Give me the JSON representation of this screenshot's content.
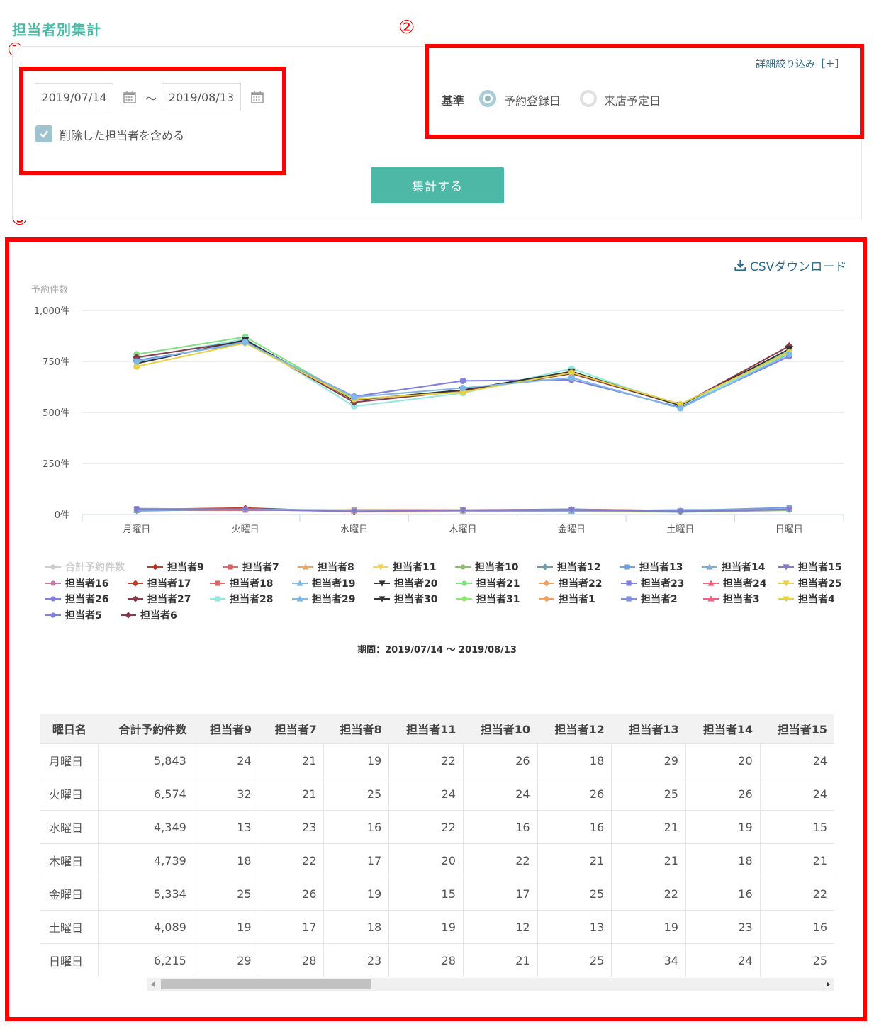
{
  "page": {
    "title": "担当者別集計"
  },
  "annotations": [
    "①",
    "②",
    "③"
  ],
  "filter": {
    "date_from": "2019/07/14",
    "date_to": "2019/08/13",
    "range_sep": "～",
    "include_deleted_label": "削除した担当者を含める",
    "detail_filter_link": "詳細絞り込み［＋］",
    "basis_label": "基準",
    "basis_options": [
      {
        "label": "予約登録日",
        "selected": true
      },
      {
        "label": "来店予定日",
        "selected": false
      }
    ],
    "submit_label": "集計する"
  },
  "csv_download_label": "CSVダウンロード",
  "chart_data": {
    "type": "line",
    "ylabel": "予約件数",
    "ylim": [
      0,
      1000
    ],
    "yticks": [
      "1,000件",
      "750件",
      "500件",
      "250件",
      "0件"
    ],
    "categories": [
      "月曜日",
      "火曜日",
      "水曜日",
      "木曜日",
      "金曜日",
      "土曜日",
      "日曜日"
    ],
    "period_label": "期間：2019/07/14 ～ 2019/08/13",
    "series": [
      {
        "name": "合計予約件数",
        "color": "#cccccc",
        "marker": "circle",
        "hidden": true,
        "values": [
          5843,
          6574,
          4349,
          4739,
          5334,
          4089,
          6215
        ]
      },
      {
        "name": "担当者9",
        "color": "#c0392b",
        "marker": "diamond",
        "values": [
          24,
          32,
          13,
          18,
          25,
          19,
          29
        ]
      },
      {
        "name": "担当者7",
        "color": "#e06666",
        "marker": "square",
        "values": [
          21,
          21,
          23,
          22,
          26,
          17,
          28
        ]
      },
      {
        "name": "担当者8",
        "color": "#f0a860",
        "marker": "triangle",
        "values": [
          19,
          25,
          16,
          17,
          19,
          18,
          23
        ]
      },
      {
        "name": "担当者11",
        "color": "#f5d35a",
        "marker": "triangle-down",
        "values": [
          22,
          24,
          22,
          20,
          15,
          19,
          28
        ]
      },
      {
        "name": "担当者10",
        "color": "#8fbc6f",
        "marker": "circle",
        "values": [
          26,
          24,
          16,
          22,
          17,
          12,
          21
        ]
      },
      {
        "name": "担当者12",
        "color": "#6f98a8",
        "marker": "diamond",
        "values": [
          18,
          26,
          16,
          21,
          25,
          13,
          25
        ]
      },
      {
        "name": "担当者13",
        "color": "#6fa0e0",
        "marker": "square",
        "values": [
          29,
          25,
          21,
          21,
          22,
          19,
          34
        ]
      },
      {
        "name": "担当者14",
        "color": "#7aaedc",
        "marker": "triangle",
        "values": [
          20,
          26,
          19,
          18,
          16,
          23,
          24
        ]
      },
      {
        "name": "担当者15",
        "color": "#8878cc",
        "marker": "triangle-down",
        "values": [
          24,
          24,
          15,
          21,
          22,
          16,
          25
        ]
      },
      {
        "name": "担当者16",
        "color": "#c47aa8",
        "marker": "circle",
        "values": []
      },
      {
        "name": "担当者17",
        "color": "#c0392b",
        "marker": "diamond",
        "values": []
      },
      {
        "name": "担当者18",
        "color": "#e06666",
        "marker": "square",
        "values": []
      },
      {
        "name": "担当者19",
        "color": "#7fb8e0",
        "marker": "triangle",
        "values": []
      },
      {
        "name": "担当者20",
        "color": "#333333",
        "marker": "triangle-down",
        "values": []
      },
      {
        "name": "担当者21",
        "color": "#7ee07e",
        "marker": "circle",
        "values": []
      },
      {
        "name": "担当者22",
        "color": "#f0a060",
        "marker": "diamond",
        "values": []
      },
      {
        "name": "担当者23",
        "color": "#7f80e0",
        "marker": "square",
        "values": []
      },
      {
        "name": "担当者24",
        "color": "#f06080",
        "marker": "triangle",
        "values": []
      },
      {
        "name": "担当者25",
        "color": "#e8d040",
        "marker": "triangle-down",
        "values": []
      },
      {
        "name": "担当者26",
        "color": "#7f80e0",
        "marker": "circle",
        "values": []
      },
      {
        "name": "担当者27",
        "color": "#8b3a4a",
        "marker": "diamond",
        "values": []
      },
      {
        "name": "担当者28",
        "color": "#90e8e0",
        "marker": "square",
        "values": []
      },
      {
        "name": "担当者29",
        "color": "#7fb8e8",
        "marker": "triangle",
        "values": []
      },
      {
        "name": "担当者30",
        "color": "#333333",
        "marker": "triangle-down",
        "values": []
      },
      {
        "name": "担当者31",
        "color": "#90e870",
        "marker": "circle",
        "values": []
      },
      {
        "name": "担当者1",
        "color": "#f0a060",
        "marker": "diamond",
        "values": []
      },
      {
        "name": "担当者2",
        "color": "#8090e0",
        "marker": "square",
        "values": []
      },
      {
        "name": "担当者3",
        "color": "#f06080",
        "marker": "triangle",
        "values": []
      },
      {
        "name": "担当者4",
        "color": "#e8d040",
        "marker": "triangle-down",
        "values": []
      },
      {
        "name": "担当者5",
        "color": "#7f80e0",
        "marker": "circle",
        "values": []
      },
      {
        "name": "担当者6",
        "color": "#8b3a4a",
        "marker": "diamond",
        "values": []
      }
    ],
    "upper_lines": [
      {
        "color": "#7ee07e",
        "values": [
          785,
          870,
          565,
          600,
          700,
          540,
          800
        ]
      },
      {
        "color": "#90e8e0",
        "values": [
          765,
          860,
          530,
          595,
          715,
          530,
          790
        ]
      },
      {
        "color": "#7f80e0",
        "values": [
          755,
          840,
          578,
          655,
          660,
          525,
          775
        ]
      },
      {
        "color": "#8b3a4a",
        "values": [
          770,
          850,
          550,
          605,
          690,
          535,
          825
        ]
      },
      {
        "color": "#333333",
        "values": [
          740,
          855,
          560,
          610,
          700,
          535,
          810
        ]
      },
      {
        "color": "#e8d040",
        "values": [
          725,
          840,
          565,
          600,
          695,
          540,
          795
        ]
      },
      {
        "color": "#7fb8e8",
        "values": [
          750,
          845,
          575,
          620,
          670,
          520,
          785
        ]
      }
    ]
  },
  "table": {
    "headers": [
      "曜日名",
      "合計予約件数",
      "担当者9",
      "担当者7",
      "担当者8",
      "担当者11",
      "担当者10",
      "担当者12",
      "担当者13",
      "担当者14",
      "担当者15"
    ],
    "rows": [
      [
        "月曜日",
        "5,843",
        "24",
        "21",
        "19",
        "22",
        "26",
        "18",
        "29",
        "20",
        "24"
      ],
      [
        "火曜日",
        "6,574",
        "32",
        "21",
        "25",
        "24",
        "24",
        "26",
        "25",
        "26",
        "24"
      ],
      [
        "水曜日",
        "4,349",
        "13",
        "23",
        "16",
        "22",
        "16",
        "16",
        "21",
        "19",
        "15"
      ],
      [
        "木曜日",
        "4,739",
        "18",
        "22",
        "17",
        "20",
        "22",
        "21",
        "21",
        "18",
        "21"
      ],
      [
        "金曜日",
        "5,334",
        "25",
        "26",
        "19",
        "15",
        "17",
        "25",
        "22",
        "16",
        "22"
      ],
      [
        "土曜日",
        "4,089",
        "19",
        "17",
        "18",
        "19",
        "12",
        "13",
        "19",
        "23",
        "16"
      ],
      [
        "日曜日",
        "6,215",
        "29",
        "28",
        "23",
        "28",
        "21",
        "25",
        "34",
        "24",
        "25"
      ]
    ]
  }
}
